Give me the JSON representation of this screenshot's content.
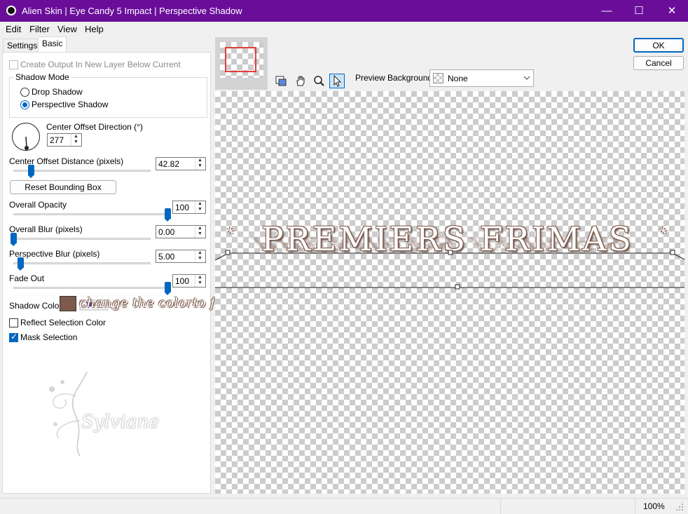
{
  "window": {
    "title": "Alien Skin | Eye Candy 5 Impact | Perspective Shadow",
    "controls": {
      "minimize": "—",
      "maximize": "☐",
      "close": "✕"
    },
    "titlebar_color": "#6a0e9a"
  },
  "menu": [
    "Edit",
    "Filter",
    "View",
    "Help"
  ],
  "tabs": [
    {
      "label": "Settings",
      "active": false
    },
    {
      "label": "Basic",
      "active": true
    }
  ],
  "options": {
    "create_output_label": "Create Output In New Layer Below Current",
    "shadow_mode_label": "Shadow Mode",
    "drop_shadow_label": "Drop Shadow",
    "perspective_shadow_label": "Perspective Shadow",
    "selected_mode": "Perspective Shadow"
  },
  "direction": {
    "label": "Center Offset Direction (°)",
    "value": "277"
  },
  "sliders": {
    "center_offset_distance": {
      "label": "Center Offset Distance (pixels)",
      "value": "42.82",
      "fraction": 0.13
    },
    "overall_opacity": {
      "label": "Overall Opacity",
      "value": "100",
      "fraction": 1.0
    },
    "overall_blur": {
      "label": "Overall Blur (pixels)",
      "value": "0.00",
      "fraction": 0.0
    },
    "perspective_blur": {
      "label": "Perspective Blur (pixels)",
      "value": "5.00",
      "fraction": 0.05
    },
    "fade_out": {
      "label": "Fade Out",
      "value": "100",
      "fraction": 1.0
    }
  },
  "reset_bounding_box_label": "Reset Bounding Box",
  "shadow_color": {
    "label": "Shadow Color",
    "color": "#7d5a4b",
    "annotation": "change the colorto foreground"
  },
  "reflect_selection_label": "Reflect Selection Color",
  "mask_selection_label": "Mask Selection",
  "watermark": "Sylviane",
  "buttons": {
    "ok": "OK",
    "cancel": "Cancel"
  },
  "preview_toolbar": {
    "tools": [
      "navigator-icon",
      "hand-icon",
      "zoom-icon",
      "pointer-icon"
    ],
    "background_label": "Preview Background:",
    "background_value": "None"
  },
  "preview": {
    "text": "PREMIERS FRIMAS",
    "ornament": "*",
    "text_color": "#7d5a4b"
  },
  "status": {
    "zoom": "100%"
  }
}
